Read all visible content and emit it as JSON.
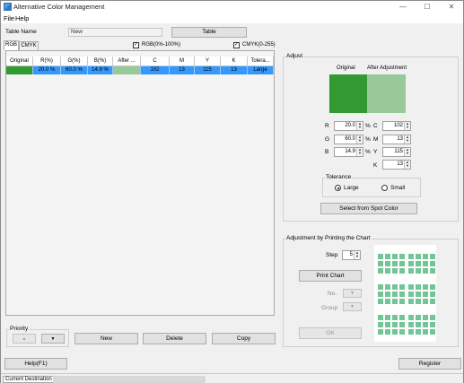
{
  "window": {
    "title": "Alternative Color Management",
    "controls": {
      "minimize": "—",
      "maximize": "☐",
      "close": "✕"
    }
  },
  "menu": [
    "File",
    "Help"
  ],
  "table_name": {
    "label": "Table Name",
    "value": "New",
    "table_button": "Table"
  },
  "tabs": [
    "RGB",
    "CMYK"
  ],
  "checkboxes": {
    "rgb": "RGB(0%-100%)",
    "cmyk": "CMYK(0-255)",
    "rgb_checked": true,
    "cmyk_checked": true
  },
  "table": {
    "headers": [
      "Original",
      "R(%)",
      "G(%)",
      "B(%)",
      "After ...",
      "C",
      "M",
      "Y",
      "K",
      "Tolera..."
    ],
    "rows": [
      {
        "original_color": "#339933",
        "r": "20.0 %",
        "g": "60.0 %",
        "b": "14.9 %",
        "after_color": "#99c899",
        "c": "102",
        "m": "13",
        "y": "115",
        "k": "13",
        "tolerance": "Large"
      }
    ]
  },
  "priority": {
    "label": "Priority",
    "up": "▲",
    "down": "▼"
  },
  "actions": {
    "new": "New",
    "delete": "Delete",
    "copy": "Copy"
  },
  "adjust": {
    "label": "Adjust",
    "original_label": "Original",
    "after_label": "After Adjustment",
    "original_color": "#339933",
    "after_color": "#99c899",
    "fields": {
      "r": {
        "label": "R",
        "value": "20.0",
        "unit": "%"
      },
      "g": {
        "label": "G",
        "value": "60.0",
        "unit": "%"
      },
      "b": {
        "label": "B",
        "value": "14.9",
        "unit": "%"
      },
      "c": {
        "label": "C",
        "value": "102"
      },
      "m": {
        "label": "M",
        "value": "13"
      },
      "y": {
        "label": "Y",
        "value": "115"
      },
      "k": {
        "label": "K",
        "value": "13"
      }
    },
    "tolerance": {
      "label": "Tolerance",
      "large": "Large",
      "small": "Small",
      "selected": "Large"
    },
    "spot_button": "Select from Spot Color"
  },
  "chart_adjust": {
    "label": "Adjustment by Printing the Chart",
    "step_label": "Step",
    "step_value": "5",
    "print_button": "Print Chart",
    "no_label": "No.",
    "group_label": "Group",
    "ok_button": "OK",
    "chart_color": "#72c596"
  },
  "footer": {
    "help": "Help(F1)",
    "register": "Register"
  },
  "status": {
    "label": "Current Destination"
  }
}
